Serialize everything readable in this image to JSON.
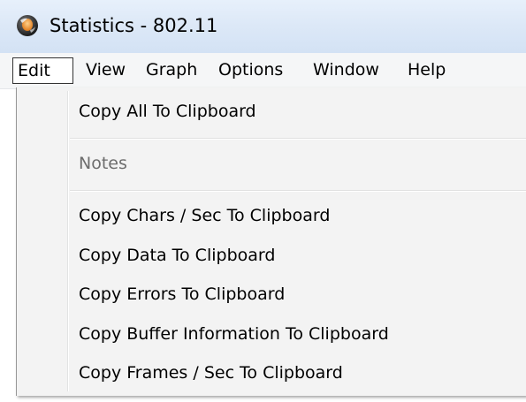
{
  "window": {
    "title": "Statistics - 802.11"
  },
  "menubar": {
    "items": [
      {
        "label": "Edit",
        "active": true
      },
      {
        "label": "View"
      },
      {
        "label": "Graph"
      },
      {
        "label": "Options"
      },
      {
        "label": "Window"
      },
      {
        "label": "Help"
      }
    ]
  },
  "edit_menu": {
    "copy_all": "Copy All To Clipboard",
    "notes": "Notes",
    "copy_chars": "Copy Chars / Sec To Clipboard",
    "copy_data": "Copy Data To Clipboard",
    "copy_errors": "Copy Errors To Clipboard",
    "copy_buffer": "Copy Buffer Information To Clipboard",
    "copy_frames": "Copy Frames / Sec To Clipboard"
  },
  "icons": {
    "app": "app-globe-icon"
  },
  "colors": {
    "titlebar": "#dce8f7",
    "menubar": "#f5f6f7",
    "menu_background": "#f3f3f3",
    "disabled_text": "#6d6d6d"
  }
}
